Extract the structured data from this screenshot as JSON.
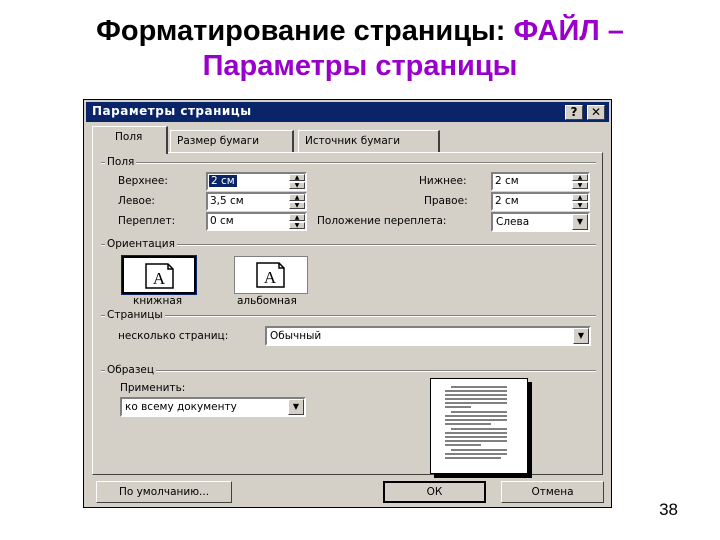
{
  "slide": {
    "title_part1": "Форматирование страницы: ",
    "title_part2": "ФАЙЛ –",
    "title_line2": "Параметры страницы",
    "page_number": "38",
    "accent_color": "#9900cc"
  },
  "dialog": {
    "title": "Параметры страницы",
    "help_button": "?",
    "close_button": "✕",
    "tabs": [
      {
        "label": "Поля",
        "active": true
      },
      {
        "label": "Размер бумаги",
        "active": false
      },
      {
        "label": "Источник бумаги",
        "active": false
      }
    ],
    "margins": {
      "group_label": "Поля",
      "top": {
        "label": "Верхнее:",
        "value": "2 см"
      },
      "left": {
        "label": "Левое:",
        "value": "3,5 см"
      },
      "gutter": {
        "label": "Переплет:",
        "value": "0 см"
      },
      "bottom": {
        "label": "Нижнее:",
        "value": "2 см"
      },
      "right": {
        "label": "Правое:",
        "value": "2 см"
      },
      "gutter_position": {
        "label": "Положение переплета:",
        "value": "Слева"
      }
    },
    "orientation": {
      "group_label": "Ориентация",
      "portrait": "книжная",
      "landscape": "альбомная",
      "selected": "portrait",
      "icon_letter": "A"
    },
    "pages": {
      "group_label": "Страницы",
      "multiple_label": "несколько страниц:",
      "multiple_value": "Обычный"
    },
    "preview": {
      "group_label": "Образец",
      "apply_label": "Применить:",
      "apply_value": "ко всему документу"
    },
    "buttons": {
      "default": "По умолчанию...",
      "ok": "ОК",
      "cancel": "Отмена"
    }
  }
}
